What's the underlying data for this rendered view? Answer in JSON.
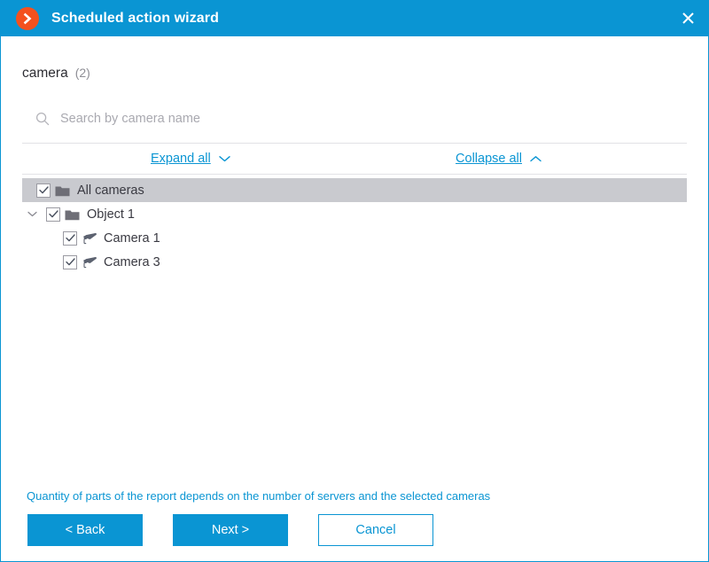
{
  "window": {
    "title": "Scheduled action wizard",
    "app_icon": "chevron-right-circle-icon",
    "close_icon": "close-icon",
    "accent_color": "#0a95d3",
    "app_icon_color": "#f4511e"
  },
  "section": {
    "title": "camera",
    "count": "(2)"
  },
  "search": {
    "placeholder": "Search by camera name",
    "value": "",
    "icon": "search-icon"
  },
  "toggles": {
    "expand_label": "Expand all",
    "expand_icon": "chevron-down-icon",
    "collapse_label": "Collapse all",
    "collapse_icon": "chevron-up-icon"
  },
  "tree": {
    "nodes": [
      {
        "label": "All cameras",
        "icon": "folder-icon",
        "checked": true,
        "selected": true,
        "expandable": false,
        "depth": 0
      },
      {
        "label": "Object 1",
        "icon": "folder-icon",
        "checked": true,
        "selected": false,
        "expandable": true,
        "expanded": true,
        "depth": 1
      },
      {
        "label": "Camera 1",
        "icon": "camera-icon",
        "checked": true,
        "selected": false,
        "expandable": false,
        "depth": 2
      },
      {
        "label": "Camera 3",
        "icon": "camera-icon",
        "checked": true,
        "selected": false,
        "expandable": false,
        "depth": 2
      }
    ]
  },
  "footer": {
    "hint": "Quantity of parts of the report depends on the number of servers and the selected cameras",
    "back_label": "< Back",
    "next_label": "Next >",
    "cancel_label": "Cancel"
  }
}
